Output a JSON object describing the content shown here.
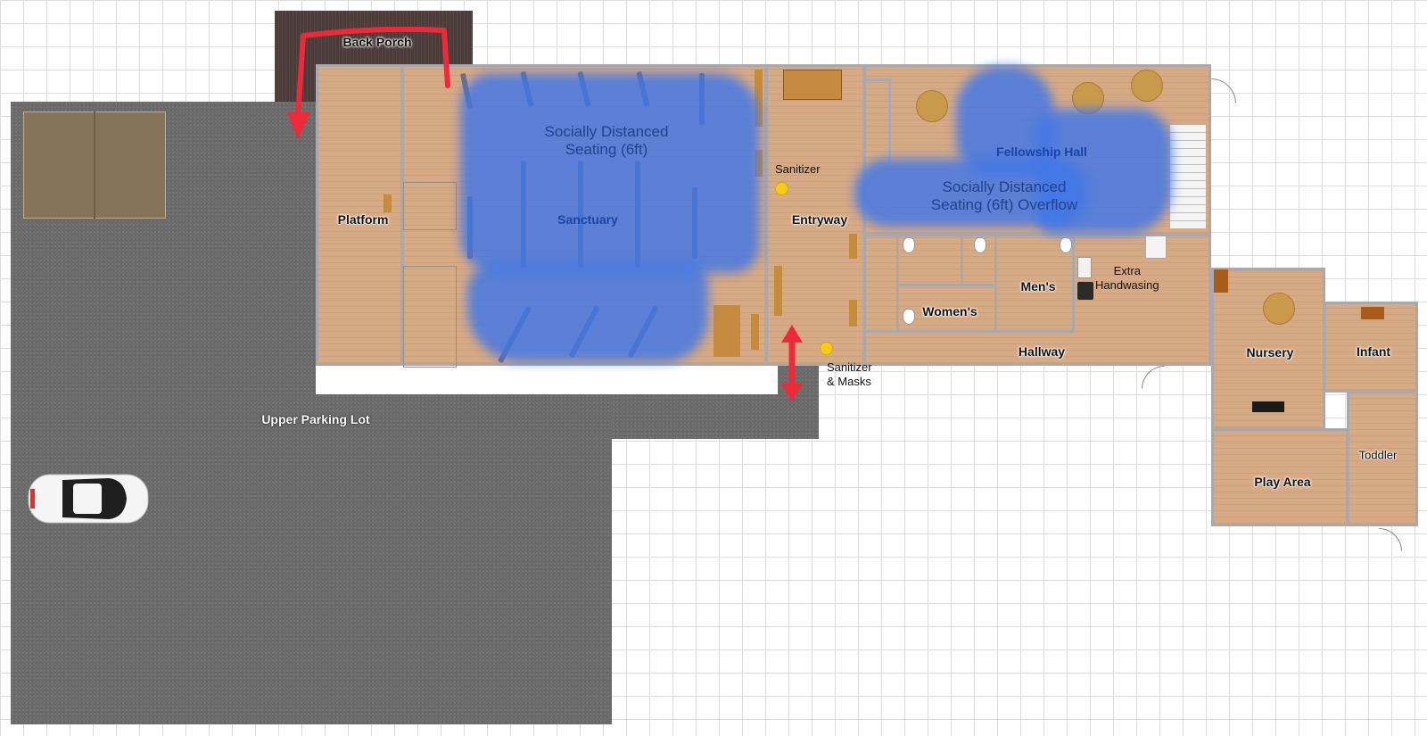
{
  "labels": {
    "back_porch": "Back Porch",
    "platform": "Platform",
    "sanctuary": "Sanctuary",
    "entryway": "Entryway",
    "fellowship_hall": "Fellowship Hall",
    "mens": "Men's",
    "womens": "Women's",
    "hallway": "Hallway",
    "nursery": "Nursery",
    "infant": "Infant",
    "toddler": "Toddler",
    "play_area": "Play Area",
    "upper_parking_lot": "Upper Parking Lot"
  },
  "annotations": {
    "seating_line1": "Socially Distanced",
    "seating_line2": "Seating (6ft)",
    "overflow_line1": "Socially Distanced",
    "overflow_line2": "Seating (6ft) Overflow",
    "sanitizer": "Sanitizer",
    "sanitizer_masks_line1": "Sanitizer",
    "sanitizer_masks_line2": "& Masks",
    "extra_line1": "Extra",
    "extra_line2": "Handwasing"
  },
  "colors": {
    "arrow": "#ee2a3a",
    "seating_zone": "#4076e8",
    "sanitizer_dot": "#f4cc1c",
    "floor": "#d7aa86",
    "asphalt": "#6b6b6b"
  },
  "icons": {
    "car": "car-icon",
    "sanitizer": "sanitizer-dot-icon",
    "arrow": "route-arrow-icon"
  }
}
